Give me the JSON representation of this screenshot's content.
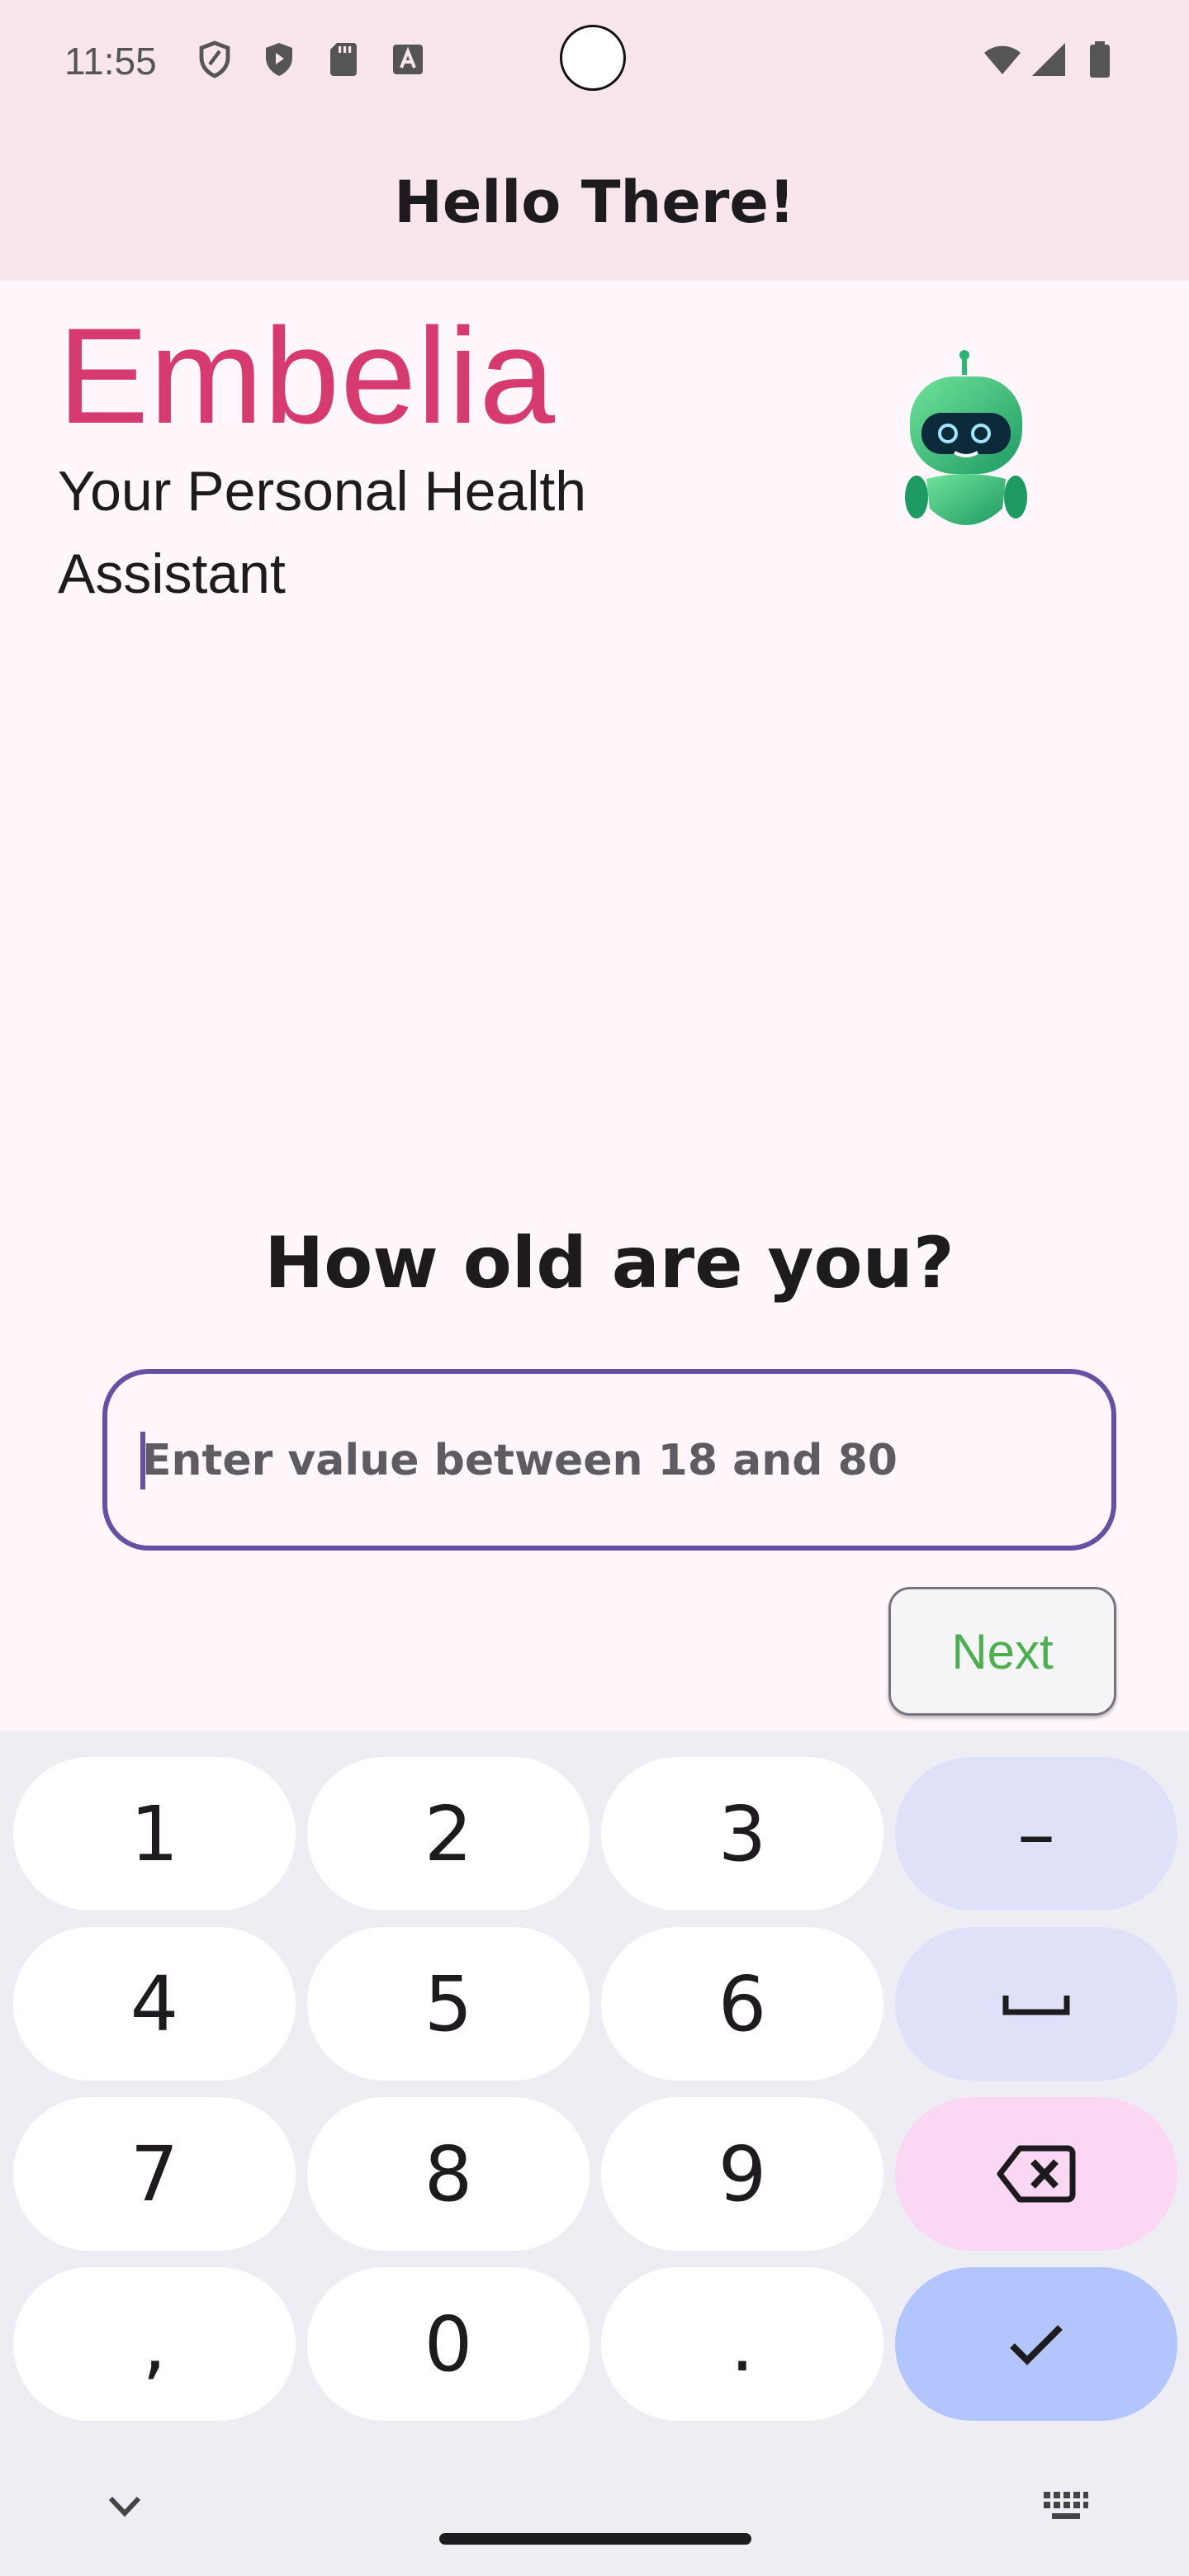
{
  "status_bar": {
    "time": "11:55",
    "left_icons": [
      "shield-outline-icon",
      "play-shield-icon",
      "sd-card-icon",
      "keyboard-a-icon"
    ],
    "right_icons": [
      "wifi-icon",
      "cellular-signal-icon",
      "battery-icon"
    ]
  },
  "app_bar": {
    "title": "Hello There!"
  },
  "brand": {
    "name": "Embelia",
    "tagline": "Your Personal Health Assistant",
    "mascot_icon": "robot-mascot-icon"
  },
  "form": {
    "question": "How old are you?",
    "age_input": {
      "value": "",
      "placeholder": "Enter value between 18 and 80"
    },
    "next_label": "Next"
  },
  "colors": {
    "brand": "#d63a6f",
    "field_border": "#6750a4",
    "next_text": "#4caf50",
    "app_bar_bg": "#f9e6ec"
  },
  "keyboard": {
    "keys": [
      {
        "label": "1",
        "kind": "digit"
      },
      {
        "label": "2",
        "kind": "digit"
      },
      {
        "label": "3",
        "kind": "digit"
      },
      {
        "label": "–",
        "kind": "func"
      },
      {
        "label": "4",
        "kind": "digit"
      },
      {
        "label": "5",
        "kind": "digit"
      },
      {
        "label": "6",
        "kind": "digit"
      },
      {
        "label": "␣",
        "kind": "func"
      },
      {
        "label": "7",
        "kind": "digit"
      },
      {
        "label": "8",
        "kind": "digit"
      },
      {
        "label": "9",
        "kind": "digit"
      },
      {
        "label": "",
        "kind": "del"
      },
      {
        "label": ",",
        "kind": "digit"
      },
      {
        "label": "0",
        "kind": "digit"
      },
      {
        "label": ".",
        "kind": "digit"
      },
      {
        "label": "",
        "kind": "done"
      }
    ],
    "bottom_left_icon": "chevron-down-icon",
    "bottom_right_icon": "keyboard-switch-icon"
  }
}
